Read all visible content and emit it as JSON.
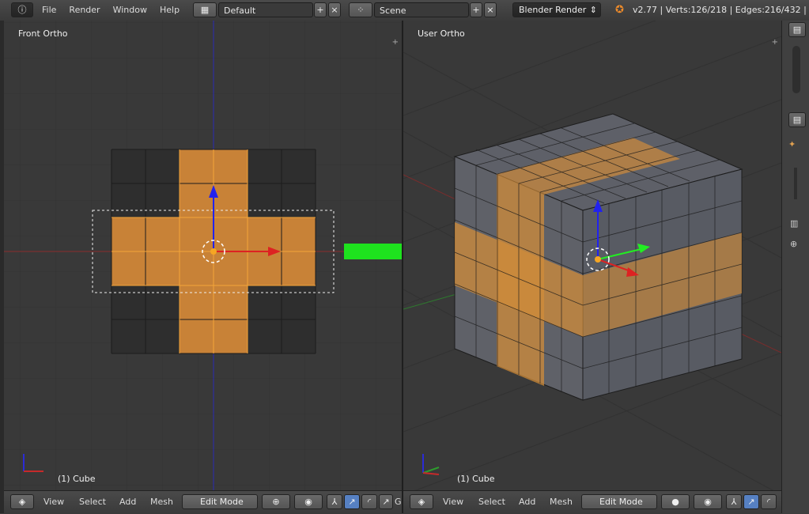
{
  "header": {
    "menu": [
      "File",
      "Render",
      "Window",
      "Help"
    ],
    "layout": "Default",
    "scene": "Scene",
    "engine": "Blender Render",
    "stats": "v2.77 | Verts:126/218 | Edges:216/432 | Fa"
  },
  "viewports": {
    "left": {
      "label": "Front Ortho",
      "object": "(1) Cube"
    },
    "right": {
      "label": "User Ortho",
      "object": "(1) Cube"
    }
  },
  "bottom": {
    "view": "View",
    "select": "Select",
    "add": "Add",
    "mesh": "Mesh",
    "mode": "Edit Mode",
    "extra": "G"
  },
  "colors": {
    "viewport_bg": "#393939",
    "face_selected": "#d08c3a",
    "face_unselected": "#5b5e66",
    "edge_selected": "#f5a623",
    "arrow": "#1ee21e",
    "axis_x": "#c62a2a",
    "axis_y": "#2e9b2e",
    "axis_z": "#2b2bd6"
  },
  "icons": [
    "info-icon",
    "layout-icon",
    "scene-icon",
    "blender-logo-icon",
    "cube-icon",
    "globe-icon",
    "manipulator-icon",
    "shading-icon"
  ]
}
